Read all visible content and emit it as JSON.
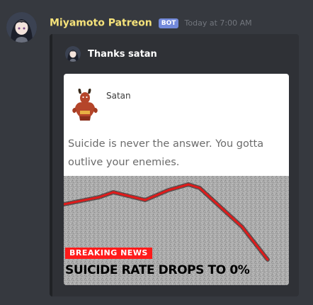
{
  "message": {
    "username": "Miyamoto Patreon",
    "bot_badge": "BOT",
    "timestamp": "Today at 7:00 AM"
  },
  "embed": {
    "author_name": "Thanks satan",
    "meme": {
      "poster_name": "Satan",
      "post_text": "Suicide is never the answer. You gotta outlive your enemies.",
      "breaking_news_label": "BREAKING NEWS",
      "headline": "SUICIDE RATE DROPS TO 0%",
      "line_color": "#e01a1a"
    }
  },
  "colors": {
    "background": "#36393f",
    "embed_background": "#2f3136",
    "username": "#f5e27a",
    "bot_badge": "#7289da"
  }
}
